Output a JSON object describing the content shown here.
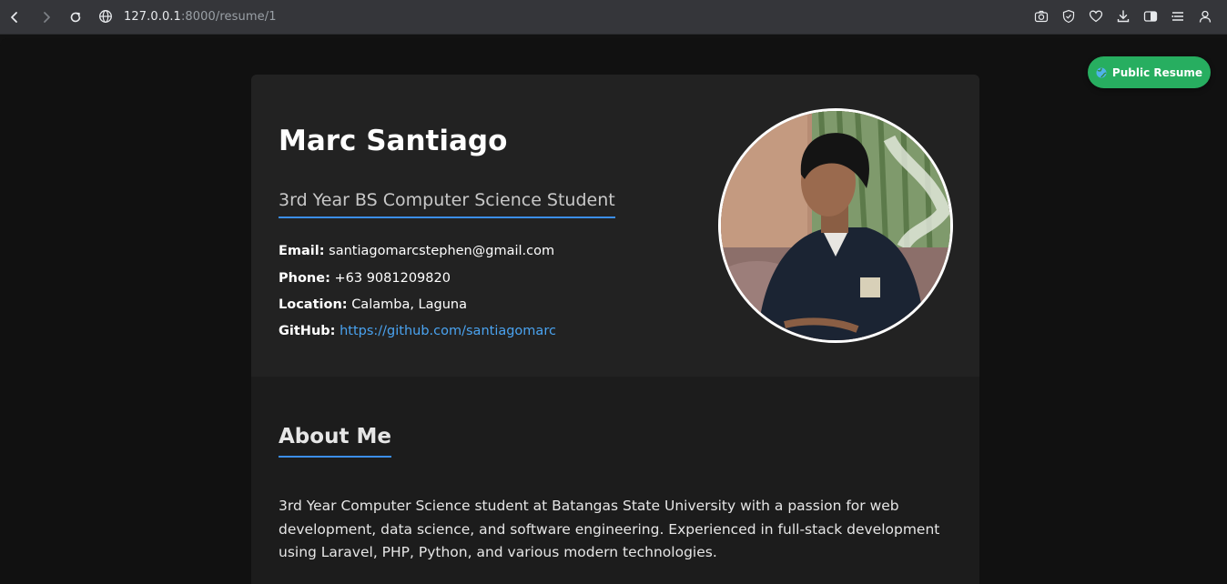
{
  "browser": {
    "url_host": "127.0.0.1",
    "url_path": ":8000/resume/1",
    "back_icon": "chevron-left-icon",
    "forward_icon": "chevron-right-icon",
    "reload_icon": "reload-icon",
    "site_icon": "globe-icon",
    "toolbar_icons": [
      "camera-icon",
      "shield-icon",
      "heart-icon",
      "download-icon",
      "sidebar-icon",
      "menu-icon",
      "profile-icon"
    ]
  },
  "page": {
    "public_button": {
      "label": "Public Resume",
      "icon": "globe-icon",
      "color": "#27ae60"
    },
    "profile": {
      "name": "Marc Santiago",
      "title": "3rd Year BS Computer Science Student",
      "email_label": "Email:",
      "email": "santiagomarcstephen@gmail.com",
      "phone_label": "Phone:",
      "phone": "+63 9081209820",
      "location_label": "Location:",
      "location": "Calamba, Laguna",
      "github_label": "GitHub:",
      "github": "https://github.com/santiagomarc"
    },
    "about": {
      "heading": "About Me",
      "lines": [
        "3rd Year Computer Science student at Batangas State University with a passion for web",
        "development, data science, and software engineering. Experienced in full-stack development",
        "using Laravel, PHP, Python, and various modern technologies."
      ]
    },
    "accent_color": "#3b8eea",
    "link_color": "#4aa3f0"
  }
}
